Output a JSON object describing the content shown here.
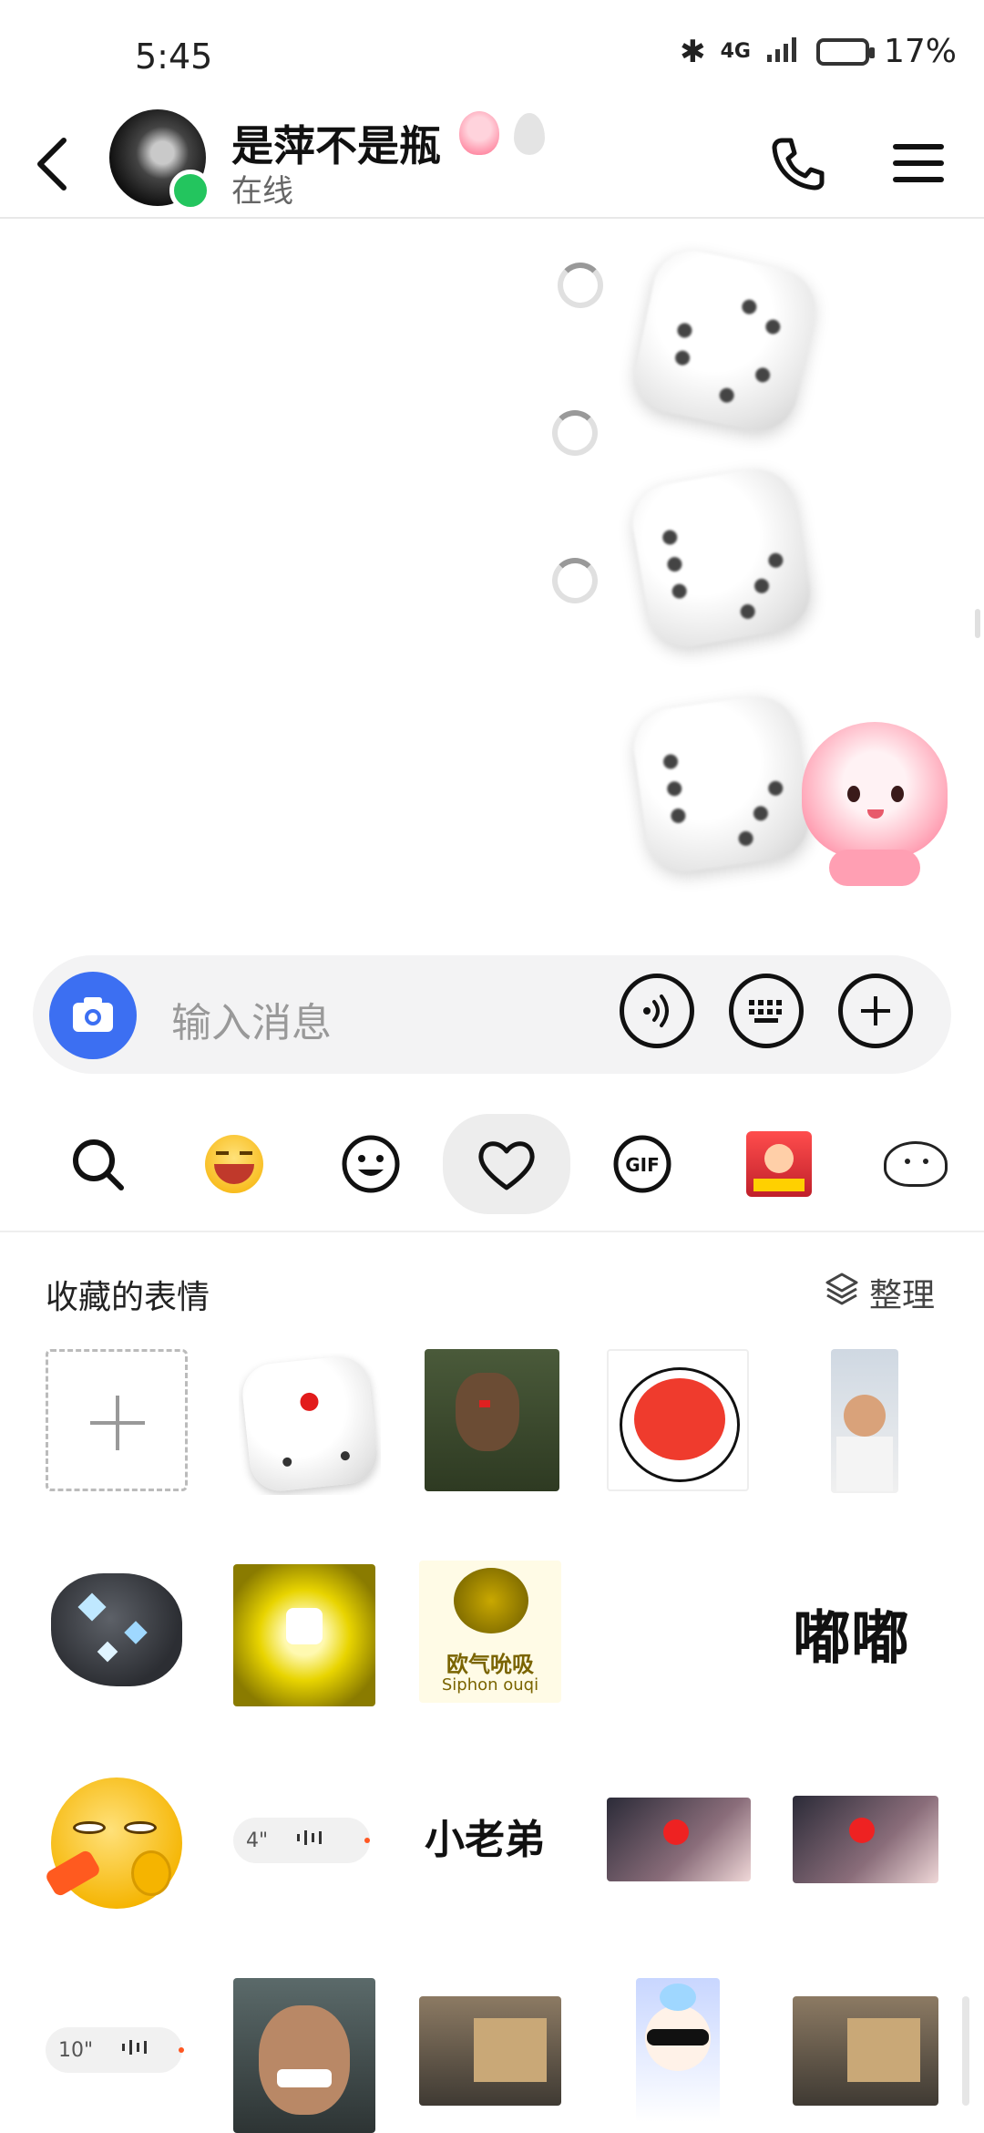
{
  "status_bar": {
    "time": "5:45",
    "network": "4G",
    "battery": "17%"
  },
  "header": {
    "contact_name": "是萍不是瓶",
    "presence": "在线"
  },
  "input": {
    "placeholder": "输入消息"
  },
  "favorites": {
    "title": "收藏的表情",
    "organize_label": "整理",
    "voice_clips": [
      "4\"",
      "10\""
    ],
    "text_stickers": [
      "嘟嘟",
      "小老弟"
    ],
    "meme_text": [
      "欧气吮吸",
      "Siphon ouqi"
    ]
  },
  "icons": {
    "back": "back-arrow-icon",
    "call": "phone-icon",
    "menu": "menu-icon",
    "camera": "camera-icon",
    "voice": "voice-icon",
    "keyboard": "keyboard-icon",
    "more": "plus-icon",
    "search": "search-icon",
    "heart": "heart-icon",
    "gif": "gif-icon"
  },
  "colors": {
    "accent": "#3c6ff2",
    "online": "#23c55e"
  }
}
